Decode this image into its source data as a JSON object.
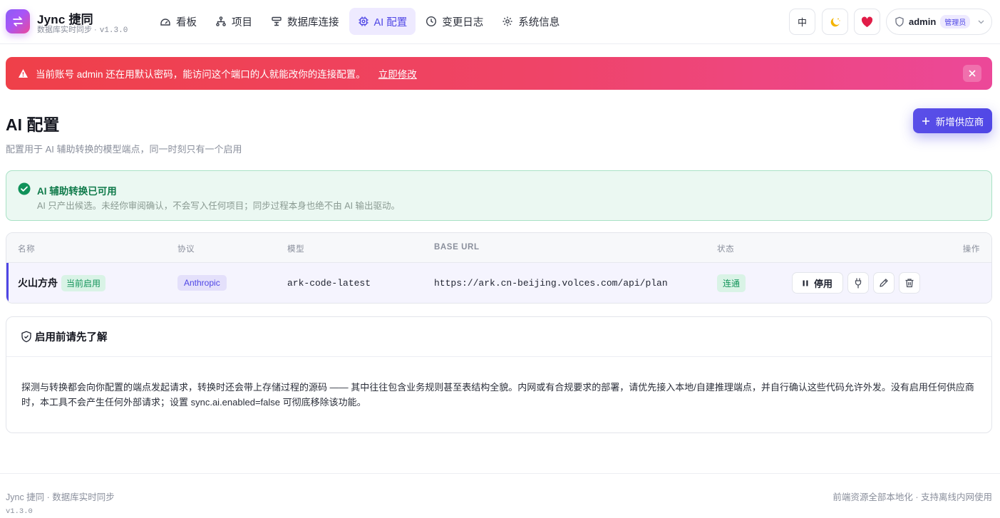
{
  "brand": {
    "name": "Jync 捷同",
    "subtitle": "数据库实时同步 ·",
    "version": "v1.3.0"
  },
  "nav": [
    {
      "label": "看板",
      "icon": "dashboard-icon"
    },
    {
      "label": "项目",
      "icon": "project-tree-icon"
    },
    {
      "label": "数据库连接",
      "icon": "database-connection-icon"
    },
    {
      "label": "AI 配置",
      "icon": "ai-chip-icon",
      "active": true
    },
    {
      "label": "变更日志",
      "icon": "clock-icon"
    },
    {
      "label": "系统信息",
      "icon": "gear-icon"
    }
  ],
  "header": {
    "lang_label": "中",
    "theme_icon": "moon-icon",
    "favorite_icon": "heart-icon",
    "user": {
      "name": "admin",
      "role": "管理员"
    }
  },
  "alert": {
    "message": "当前账号 admin 还在用默认密码，能访问这个端口的人就能改你的连接配置。",
    "link": "立即修改"
  },
  "page": {
    "title": "AI 配置",
    "description": "配置用于 AI 辅助转换的模型端点，同一时刻只有一个启用",
    "add_button": "新增供应商"
  },
  "status_card": {
    "title": "AI 辅助转换已可用",
    "subtitle": "AI 只产出候选。未经你审阅确认，不会写入任何项目；同步过程本身也绝不由 AI 输出驱动。"
  },
  "table": {
    "headers": {
      "name": "名称",
      "protocol": "协议",
      "model": "模型",
      "base_url": "BASE URL",
      "status": "状态",
      "actions": "操作"
    },
    "rows": [
      {
        "name": "火山方舟",
        "active_badge": "当前启用",
        "protocol": "Anthropic",
        "model": "ark-code-latest",
        "base_url": "https://ark.cn-beijing.volces.com/api/plan",
        "status": "连通",
        "stop_label": "停用"
      }
    ]
  },
  "info": {
    "title": "启用前请先了解",
    "body": "探测与转换都会向你配置的端点发起请求，转换时还会带上存储过程的源码 —— 其中往往包含业务规则甚至表结构全貌。内网或有合规要求的部署，请优先接入本地/自建推理端点，并自行确认这些代码允许外发。没有启用任何供应商时，本工具不会产生任何外部请求；设置 sync.ai.enabled=false 可彻底移除该功能。"
  },
  "footer": {
    "left": "Jync 捷同 · 数据库实时同步",
    "version": "v1.3.0",
    "right": "前端资源全部本地化 · 支持离线内网使用"
  },
  "colors": {
    "accent": "#4f46e5",
    "alert_start": "#ef4049",
    "alert_end": "#ec4899",
    "success": "#13945a"
  }
}
